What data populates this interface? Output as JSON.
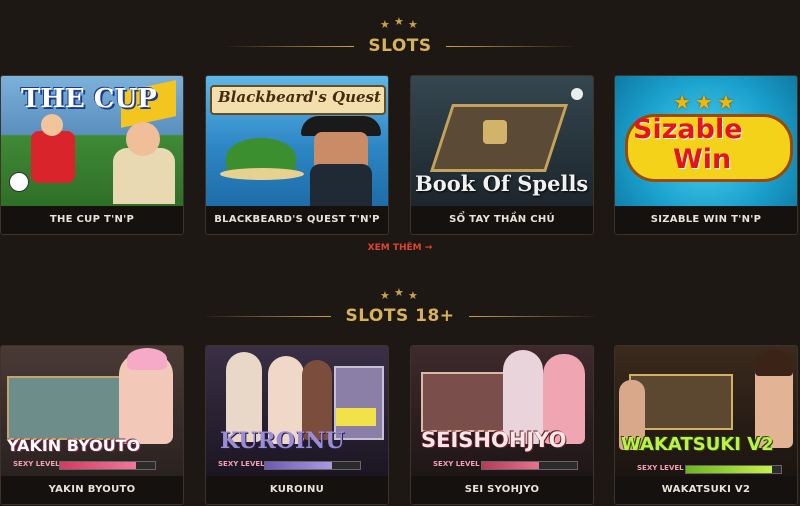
{
  "sections": [
    {
      "title": "SLOTS",
      "games": [
        {
          "name": "THE CUP T'N'P",
          "logo": "THE CUP"
        },
        {
          "name": "BLACKBEARD'S QUEST T'N'P",
          "logo": "Blackbeard's Quest"
        },
        {
          "name": "SỔ TAY THẦN CHÚ",
          "logo": "Book Of Spells"
        },
        {
          "name": "SIZABLE WIN T'N'P",
          "logo_line1": "Sizable",
          "logo_line2": "Win"
        }
      ],
      "more_label": "XEM THÊM →"
    },
    {
      "title": "SLOTS 18+",
      "games": [
        {
          "name": "YAKIN BYOUTO",
          "logo": "YAKIN BYOUTO",
          "sexy_level_label": "SEXY LEVEL",
          "sexy_level": 0.8
        },
        {
          "name": "KUROINU",
          "logo": "KUROINU",
          "sexy_level_label": "SEXY LEVEL",
          "sexy_level": 0.7
        },
        {
          "name": "SEI SYOHJYO",
          "logo": "SEISHOHJYO",
          "sexy_level_label": "SEXY LEVEL",
          "sexy_level": 0.6
        },
        {
          "name": "WAKATSUKI V2",
          "logo": "WAKATSUKI V2",
          "sexy_level_label": "SEXY LEVEL",
          "sexy_level": 0.9
        }
      ]
    }
  ],
  "colors": {
    "accent_gold": "#c9a24a",
    "more_link": "#e0452c",
    "background": "#1e1814"
  }
}
